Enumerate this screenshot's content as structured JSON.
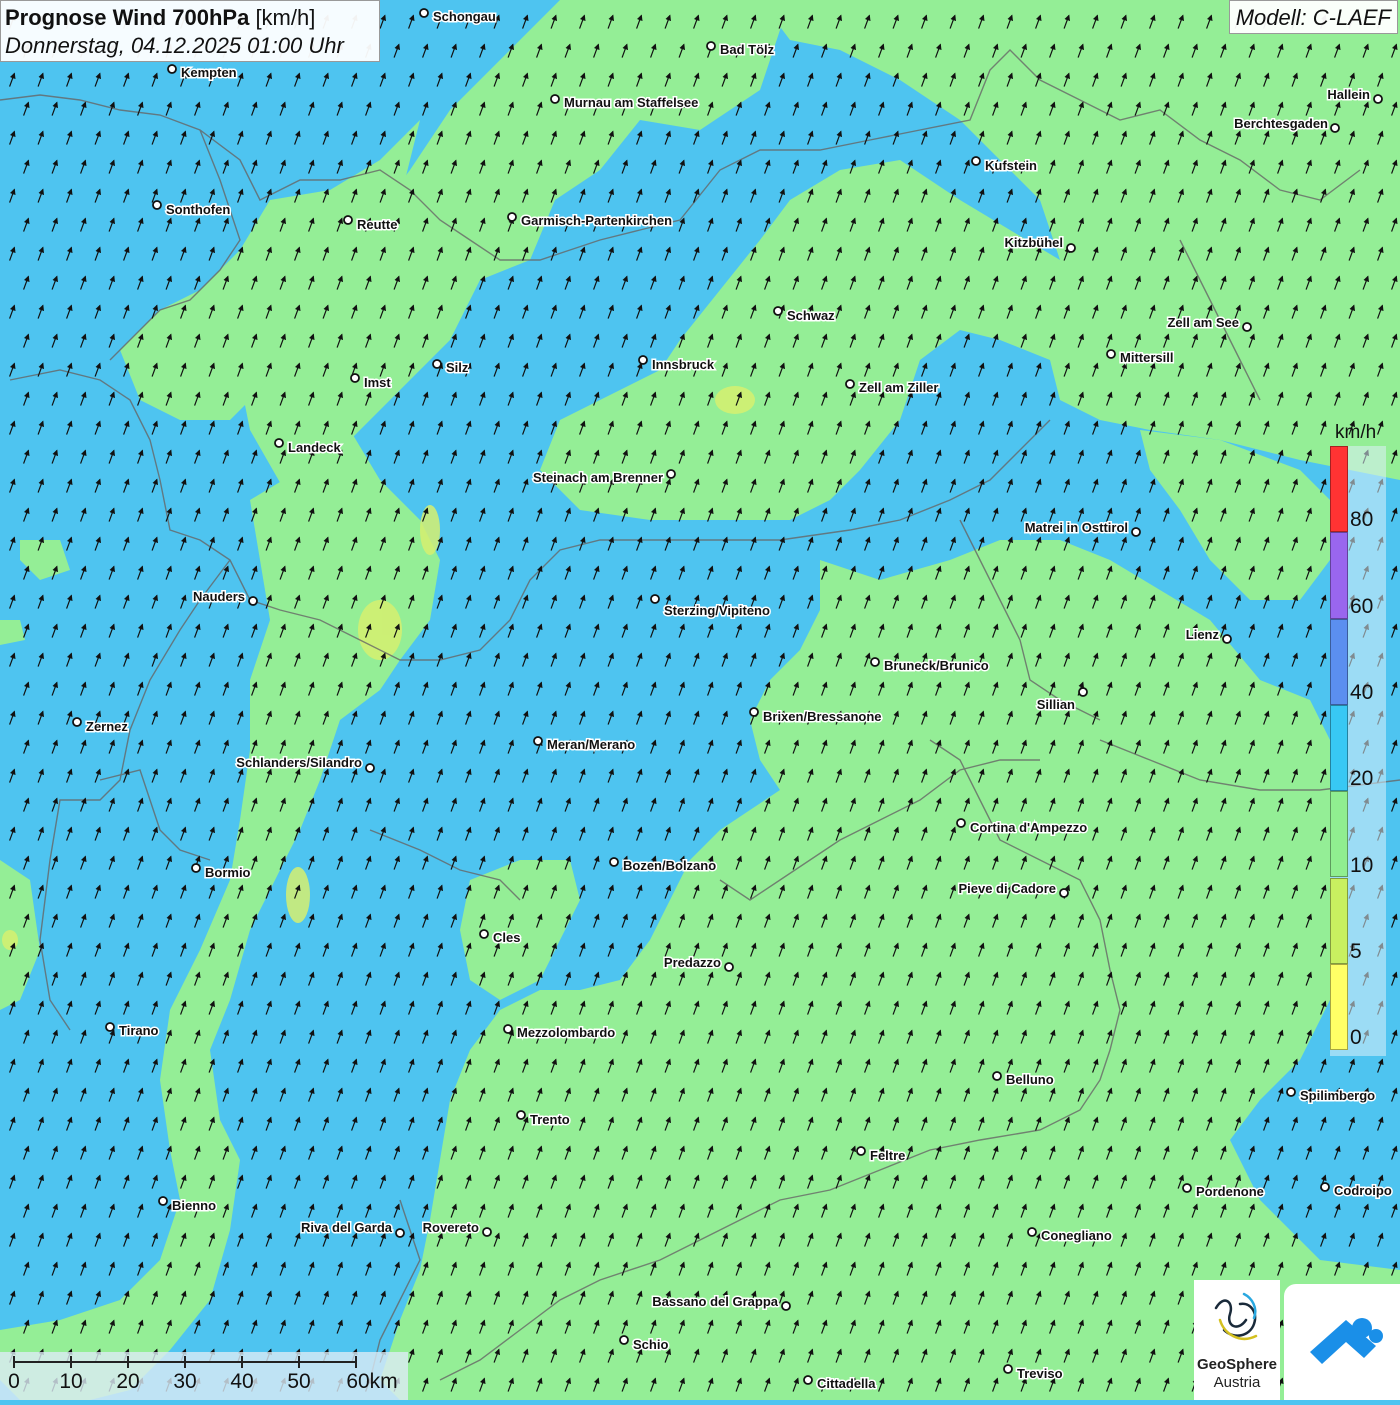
{
  "header": {
    "title_bold": "Prognose Wind 700hPa",
    "title_unit": "[km/h]",
    "datetime": "Donnerstag, 04.12.2025 01:00 Uhr"
  },
  "model": {
    "label": "Modell: C-LAEF"
  },
  "legend": {
    "unit": "km/h",
    "colors": [
      "#ffff66",
      "#c8f060",
      "#90ee90",
      "#38c8f4",
      "#5b8ff0",
      "#9966ee",
      "#ff3333"
    ],
    "ticks": [
      "0",
      "5",
      "10",
      "20",
      "40",
      "60",
      "80"
    ]
  },
  "scale_bar": {
    "labels": [
      "0",
      "10",
      "20",
      "30",
      "40",
      "50",
      "60km"
    ]
  },
  "wind": {
    "direction": "from south-southwest",
    "arrow_heading_deg": 20
  },
  "cities": [
    "Schongau",
    "Bad Tölz",
    "Kempten",
    "Murnau am Staffelsee",
    "Hallein",
    "Berchtesgaden",
    "Kufstein",
    "Sonthofen",
    "Reutte",
    "Garmisch-Partenkirchen",
    "Kitzbühel",
    "Schwaz",
    "Zell am See",
    "Mittersill",
    "Imst",
    "Silz",
    "Innsbruck",
    "Zell am Ziller",
    "Landeck",
    "Steinach am Brenner",
    "Matrei in Osttirol",
    "Nauders",
    "Sterzing/Vipiteno",
    "Lienz",
    "Bruneck/Brunico",
    "Sillian",
    "Zernez",
    "Brixen/Bressanone",
    "Meran/Merano",
    "Schlanders/Silandro",
    "Cortina d'Ampezzo",
    "Bormio",
    "Bozen/Bolzano",
    "Pieve di Cadore",
    "Cles",
    "Predazzo",
    "Tirano",
    "Mezzolombardo",
    "Belluno",
    "Spilimbergo",
    "Trento",
    "Feltre",
    "Pordenone",
    "Codroipo",
    "Bienno",
    "Riva del Garda",
    "Rovereto",
    "Conegliano",
    "Bassano del Grappa",
    "Schio",
    "Treviso",
    "Cittadella"
  ],
  "logos": {
    "geosphere_line1": "GeoSphere",
    "geosphere_line2": "Austria"
  }
}
